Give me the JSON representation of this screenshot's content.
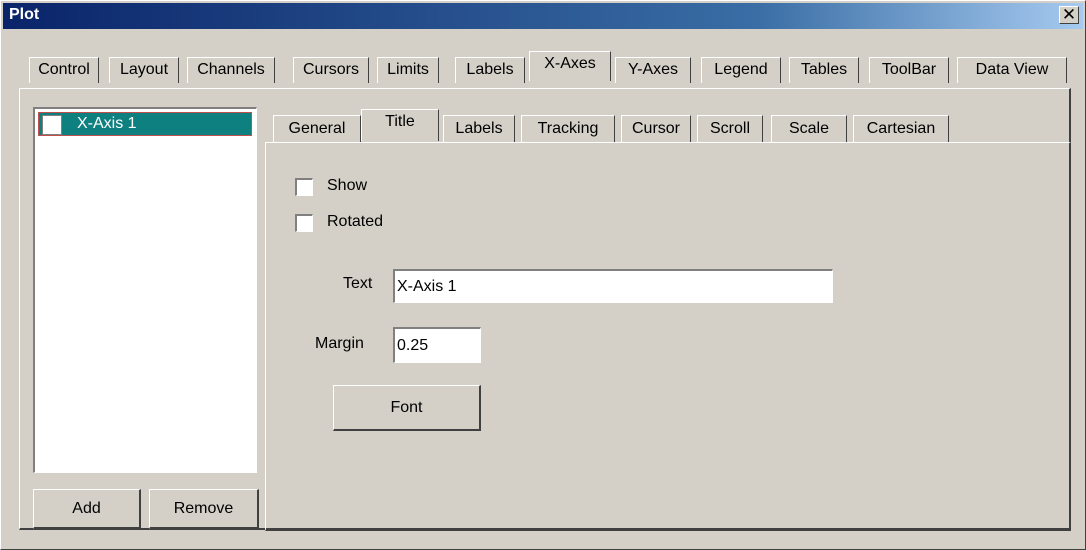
{
  "window": {
    "title": "Plot",
    "close_glyph": "✕"
  },
  "outer_tabs": [
    {
      "label": "Control"
    },
    {
      "label": "Layout"
    },
    {
      "label": "Channels"
    },
    {
      "label": "Cursors"
    },
    {
      "label": "Limits"
    },
    {
      "label": "Labels"
    },
    {
      "label": "X-Axes"
    },
    {
      "label": "Y-Axes"
    },
    {
      "label": "Legend"
    },
    {
      "label": "Tables"
    },
    {
      "label": "ToolBar"
    },
    {
      "label": "Data View"
    }
  ],
  "active_outer_tab": "X-Axes",
  "axis_list": {
    "items": [
      {
        "label": "X-Axis 1",
        "checked": false,
        "selected": true
      }
    ],
    "add_label": "Add",
    "remove_label": "Remove"
  },
  "inner_tabs": [
    {
      "label": "General"
    },
    {
      "label": "Title"
    },
    {
      "label": "Labels"
    },
    {
      "label": "Tracking"
    },
    {
      "label": "Cursor"
    },
    {
      "label": "Scroll"
    },
    {
      "label": "Scale"
    },
    {
      "label": "Cartesian"
    }
  ],
  "active_inner_tab": "Title",
  "title_panel": {
    "show_label": "Show",
    "show_checked": false,
    "rotated_label": "Rotated",
    "rotated_checked": false,
    "text_label": "Text",
    "text_value": "X-Axis 1",
    "margin_label": "Margin",
    "margin_value": "0.25",
    "font_button_label": "Font"
  },
  "colors": {
    "title_bar": "#0a246a",
    "selection": "#0f8080",
    "face": "#d4d0c8"
  }
}
